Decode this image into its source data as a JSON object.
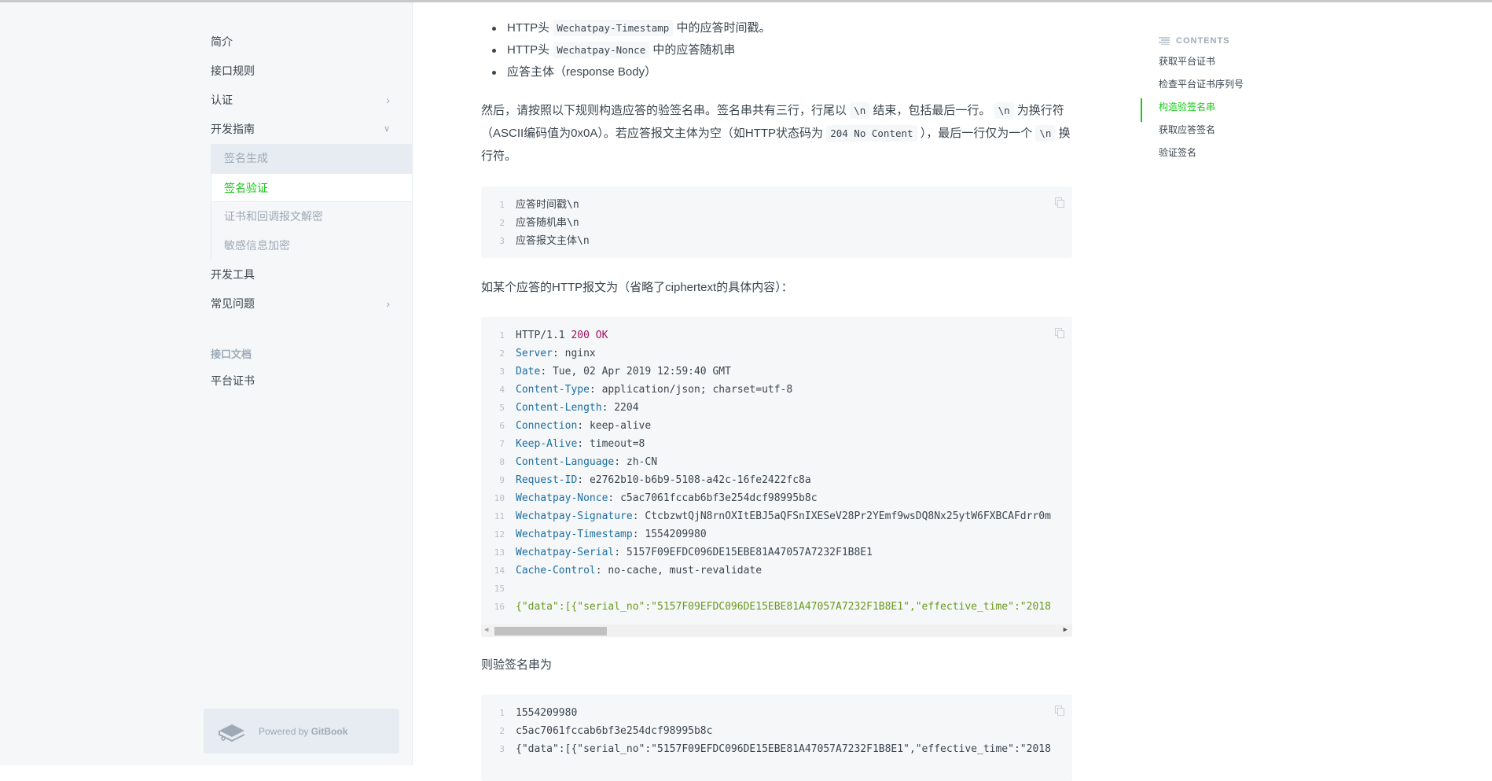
{
  "sidebar": {
    "items": [
      {
        "label": "简介"
      },
      {
        "label": "接口规则"
      },
      {
        "label": "认证",
        "chevron": "chevron-right-icon"
      },
      {
        "label": "开发指南",
        "chevron": "chevron-down-icon"
      },
      {
        "label": "开发工具"
      },
      {
        "label": "常见问题",
        "chevron": "chevron-right-icon"
      }
    ],
    "sub_items": [
      {
        "label": "签名生成"
      },
      {
        "label": "签名验证",
        "active": true
      },
      {
        "label": "证书和回调报文解密"
      },
      {
        "label": "敏感信息加密"
      }
    ],
    "group_title": "接口文档",
    "group_items": [
      {
        "label": "平台证书"
      }
    ],
    "gitbook": {
      "prefix": "Powered by ",
      "brand": "GitBook"
    }
  },
  "main": {
    "bullets": [
      {
        "pre": "HTTP头 ",
        "code": "Wechatpay-Timestamp",
        "post": " 中的应答时间戳。"
      },
      {
        "pre": "HTTP头 ",
        "code": "Wechatpay-Nonce",
        "post": " 中的应答随机串"
      },
      {
        "pre": "应答主体（response Body）",
        "code": "",
        "post": ""
      }
    ],
    "para1": {
      "t1": "然后，请按照以下规则构造应答的验签名串。签名串共有三行，行尾以 ",
      "c1": "\\n",
      "t2": " 结束，包括最后一行。 ",
      "c2": "\\n",
      "t3": " 为换行符（ASCII编码值为0x0A）。若应答报文主体为空（如HTTP状态码为 ",
      "c3": "204 No Content",
      "t4": " ），最后一行仅为一个 ",
      "c4": "\\n",
      "t5": " 换行符。"
    },
    "code1": [
      "应答时间戳\\n",
      "应答随机串\\n",
      "应答报文主体\\n"
    ],
    "para2": "如某个应答的HTTP报文为（省略了ciphertext的具体内容）：",
    "code2": [
      {
        "k": "",
        "v": "HTTP/1.1 ",
        "r": "200 OK"
      },
      {
        "k": "Server",
        "v": "nginx"
      },
      {
        "k": "Date",
        "v": "Tue, 02 Apr 2019 12:59:40 GMT"
      },
      {
        "k": "Content-Type",
        "v": "application/json; charset=utf-8"
      },
      {
        "k": "Content-Length",
        "v": "2204"
      },
      {
        "k": "Connection",
        "v": "keep-alive"
      },
      {
        "k": "Keep-Alive",
        "v": "timeout=8"
      },
      {
        "k": "Content-Language",
        "v": "zh-CN"
      },
      {
        "k": "Request-ID",
        "v": "e2762b10-b6b9-5108-a42c-16fe2422fc8a"
      },
      {
        "k": "Wechatpay-Nonce",
        "v": "c5ac7061fccab6bf3e254dcf98995b8c"
      },
      {
        "k": "Wechatpay-Signature",
        "v": "CtcbzwtQjN8rnOXItEBJ5aQFSnIXESeV28Pr2YEmf9wsDQ8Nx25ytW6FXBCAFdrr0m"
      },
      {
        "k": "Wechatpay-Timestamp",
        "v": "1554209980"
      },
      {
        "k": "Wechatpay-Serial",
        "v": "5157F09EFDC096DE15EBE81A47057A7232F1B8E1"
      },
      {
        "k": "Cache-Control",
        "v": "no-cache, must-revalidate"
      },
      {
        "k": "",
        "v": ""
      },
      {
        "k": "",
        "v": "",
        "s": "{\"data\":[{\"serial_no\":\"5157F09EFDC096DE15EBE81A47057A7232F1B8E1\",\"effective_time\":\"2018"
      }
    ],
    "code2_scroll_fraction": 0.19,
    "para3": "则验签名串为",
    "code3": [
      "1554209980",
      "c5ac7061fccab6bf3e254dcf98995b8c",
      "{\"data\":[{\"serial_no\":\"5157F09EFDC096DE15EBE81A47057A7232F1B8E1\",\"effective_time\":\"2018"
    ]
  },
  "toc": {
    "title": "CONTENTS",
    "items": [
      "获取平台证书",
      "检查平台证书序列号",
      "构造验签名串",
      "获取应答签名",
      "验证签名"
    ],
    "active_index": 2
  },
  "colors": {
    "accent": "#1ac71a",
    "key": "#1c6ea0",
    "string": "#6b9a1e",
    "status": "#a0125e"
  }
}
